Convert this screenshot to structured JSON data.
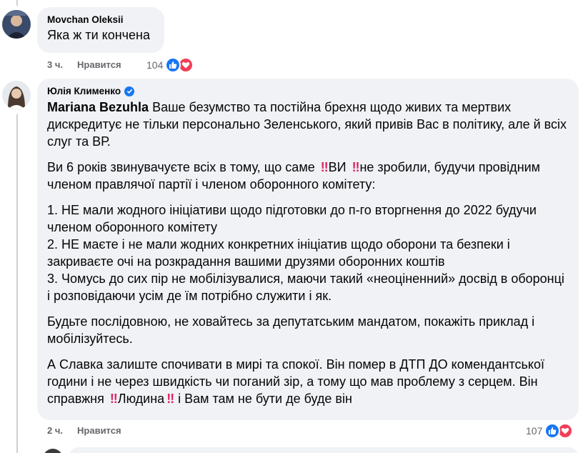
{
  "comments": [
    {
      "author": "Movchan Oleksii",
      "text": "Яка ж ти кончена",
      "time": "3 ч.",
      "like_label": "Нравится",
      "reaction_count": "104"
    },
    {
      "author": "Юлія Клименко",
      "mention": "Mariana Bezuhla",
      "p1": "Ваше безумство та постійна брехня щодо живих та мертвих дискредитує не тільки персонально Зеленського, який привів Вас в політику, але й всіх слуг та ВР.",
      "p2_a": "Ви 6 років звинувачуєте всіх в тому, що саме",
      "p2_b": "ВИ",
      "p2_c": "не зробили, будучи провідним членом правлячої партії і членом оборонного комітету:",
      "list": [
        "1. НЕ мали жодного ініціативи щодо підготовки до п-го вторгнення до 2022 будучи членом оборонного комітету",
        "2. НЕ маєте і не мали жодних конкретних ініціатив щодо оборони та безпеки і закриваєте очі на розкрадання вашими друзями оборонних коштів",
        "3. Чомусь до сих пір не мобілізувалися, маючи такий «неоціненний» досвід в оборонці і розповідаючи усім де їм потрібно служити і як."
      ],
      "p4": "Будьте послідовною, не ховайтесь за депутатським мандатом, покажіть приклад і мобілізуйтесь.",
      "p5_a": "А Славка залиште спочивати в мирі та спокої. Він помер в ДТП ДО комендантської години і не через швидкість чи поганий зір, а тому що мав проблему з серцем. Він справжня",
      "p5_b": "Людина",
      "p5_c": "і Вам там не бути де буде він",
      "time": "2 ч.",
      "like_label": "Нравится",
      "reaction_count": "107"
    }
  ],
  "icons": {
    "bangs": "‼",
    "like": "like-icon",
    "heart": "heart-icon",
    "verified": "verified-badge-icon"
  },
  "colors": {
    "bubble": "#f0f2f5",
    "like": "#1877f2",
    "heart": "#f33e58",
    "meta": "#65676b"
  }
}
